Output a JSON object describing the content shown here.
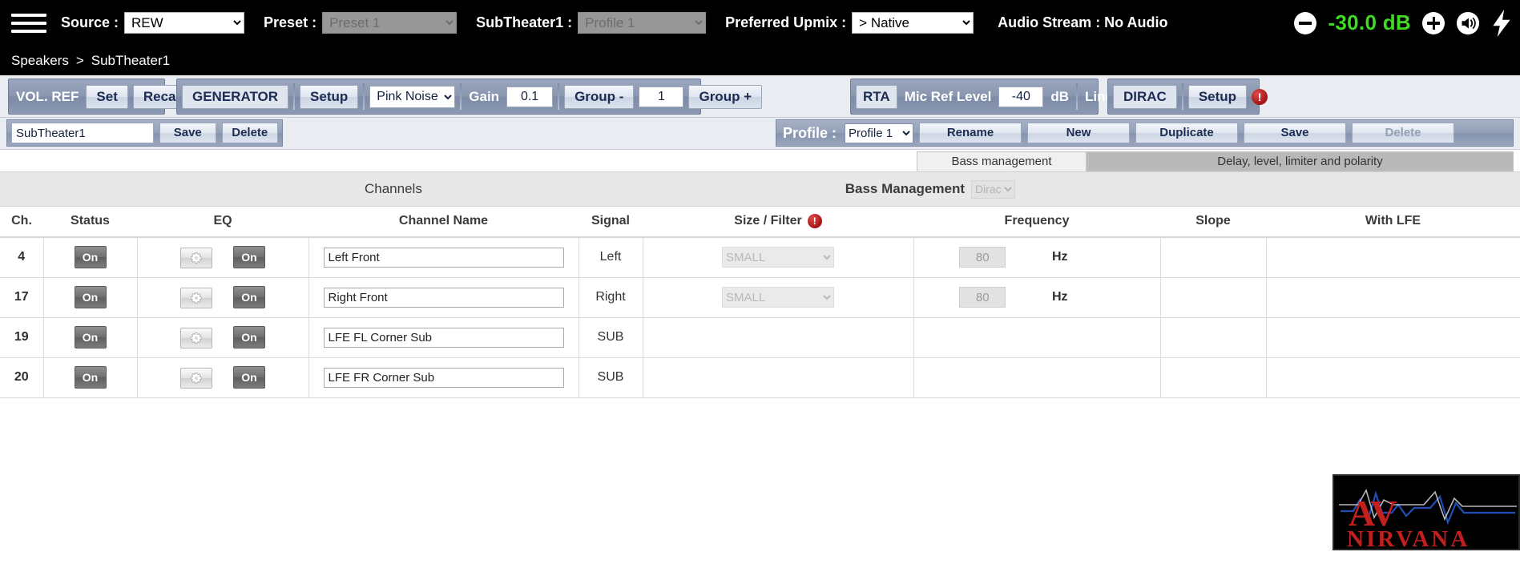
{
  "header": {
    "menu_icon": "hamburger-menu-icon",
    "source_label": "Source :",
    "source_value": "REW",
    "preset_label": "Preset :",
    "preset_value": "Preset 1",
    "subtheater_label": "SubTheater1 :",
    "subtheater_value": "Profile 1",
    "upmix_label": "Preferred Upmix :",
    "upmix_value": "> Native",
    "audio_stream": "Audio Stream : No Audio",
    "volume_value": "-30.0 dB",
    "volume_color": "#3fdb24",
    "minus_icon": "minus-circle-icon",
    "plus_icon": "plus-circle-icon",
    "speaker_icon": "speaker-volume-icon",
    "bolt_icon": "lightning-bolt-icon"
  },
  "breadcrumb": {
    "root": "Speakers",
    "separator": ">",
    "current": "SubTheater1"
  },
  "toolbar": {
    "volref": {
      "title": "VOL. REF",
      "set": "Set",
      "recall": "Recall"
    },
    "generator": {
      "title": "GENERATOR",
      "setup": "Setup",
      "signal_value": "Pink Noise",
      "gain_label": "Gain",
      "gain_value": "0.1",
      "group_minus": "Group -",
      "group_value": "1",
      "group_plus": "Group +"
    },
    "rta": {
      "title": "RTA",
      "mic_ref_label": "Mic Ref Level",
      "mic_ref_value": "-40",
      "db_unit": "dB",
      "linear_label": "Linear",
      "linear_checked": false
    },
    "dirac": {
      "title": "DIRAC",
      "setup": "Setup",
      "warn_icon": "warning-exclamation-icon",
      "warn_glyph": "!"
    }
  },
  "saverow": {
    "name_value": "SubTheater1",
    "save": "Save",
    "delete": "Delete",
    "profile_label": "Profile :",
    "profile_value": "Profile 1",
    "rename": "Rename",
    "new": "New",
    "duplicate": "Duplicate",
    "profile_save": "Save",
    "profile_delete": "Delete"
  },
  "tabs": [
    {
      "label": "Bass management",
      "active": true
    },
    {
      "label": "Delay, level, limiter and polarity",
      "active": false
    }
  ],
  "grid": {
    "section_title": "Channels",
    "bass_management_label": "Bass Management",
    "bass_management_value": "Dirac",
    "columns": {
      "ch": "Ch.",
      "status": "Status",
      "eq": "EQ",
      "channel_name": "Channel Name",
      "signal": "Signal",
      "size_filter": "Size / Filter",
      "size_filter_warn_icon": "warning-exclamation-icon",
      "size_filter_warn_glyph": "!",
      "frequency": "Frequency",
      "slope": "Slope",
      "with_lfe": "With LFE"
    },
    "rows": [
      {
        "ch": "4",
        "status": "On",
        "eq_gear_icon": "gear-icon",
        "eq": "On",
        "name": "Left Front",
        "signal": "Left",
        "size": "SMALL",
        "has_size": true,
        "frequency": "80",
        "hz": "Hz",
        "has_freq": true,
        "slope": "",
        "with_lfe": ""
      },
      {
        "ch": "17",
        "status": "On",
        "eq_gear_icon": "gear-icon",
        "eq": "On",
        "name": "Right Front",
        "signal": "Right",
        "size": "SMALL",
        "has_size": true,
        "frequency": "80",
        "hz": "Hz",
        "has_freq": true,
        "slope": "",
        "with_lfe": ""
      },
      {
        "ch": "19",
        "status": "On",
        "eq_gear_icon": "gear-icon",
        "eq": "On",
        "name": "LFE FL Corner Sub",
        "signal": "SUB",
        "size": "",
        "has_size": false,
        "frequency": "",
        "hz": "",
        "has_freq": false,
        "slope": "",
        "with_lfe": ""
      },
      {
        "ch": "20",
        "status": "On",
        "eq_gear_icon": "gear-icon",
        "eq": "On",
        "name": "LFE FR Corner Sub",
        "signal": "SUB",
        "size": "",
        "has_size": false,
        "frequency": "",
        "hz": "",
        "has_freq": false,
        "slope": "",
        "with_lfe": ""
      }
    ]
  },
  "logo": {
    "line1": "AV",
    "line2": "NIRVANA",
    "alt": "av-nirvana-logo"
  }
}
